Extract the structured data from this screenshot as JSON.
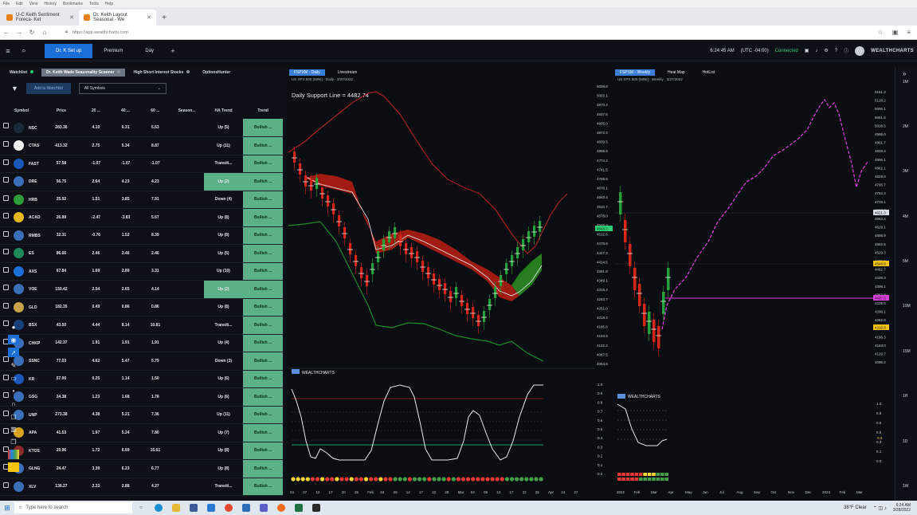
{
  "browser": {
    "menu": [
      "File",
      "Edit",
      "View",
      "History",
      "Bookmarks",
      "Tools",
      "Help"
    ],
    "tabs": [
      {
        "title": "U-C Keith Sentiment Foreca- Ket"
      },
      {
        "title": "Dr. Keith Layout Seasonal - We"
      }
    ],
    "url": "https://app.wealthcharts.com"
  },
  "app": {
    "tabs": [
      "Dr. K Set up",
      "Premium",
      "Day"
    ],
    "clock": "6:24:45 AM",
    "tz": "(UTC -04:00)",
    "status": "Connected",
    "logo": "WEALTHCHARTS"
  },
  "scanner": {
    "tabs": [
      "Watchlist",
      "Dr. Keith Wade Seasonality Scanner",
      "High Short Interest Stocks",
      "OptionsHunter"
    ],
    "add_watchlist": "Add to Watchlist",
    "filter": "All Symbols",
    "columns": [
      "Symbol",
      "Price",
      "20 ...",
      "40 ...",
      "60 ...",
      "Season...",
      "HA Trend",
      "Trend"
    ],
    "rows": [
      {
        "sym": "NSC",
        "price": "283.36",
        "c20": "4.10",
        "c40": "6.31",
        "c60": "5.63",
        "season": "",
        "ha": "Up (5)",
        "trend": "Bullish ...",
        "logo": "#1b2a3a",
        "ha_hi": false
      },
      {
        "sym": "CTAS",
        "price": "413.32",
        "c20": "2.75",
        "c40": "5.34",
        "c60": "8.87",
        "season": "",
        "ha": "Up (11)",
        "trend": "Bullish ...",
        "logo": "#f2f2f2",
        "ha_hi": false
      },
      {
        "sym": "FAST",
        "price": "57.58",
        "c20": "-1.07",
        "c40": "-1.07",
        "c60": "-1.07",
        "season": "",
        "ha": "Transiti...",
        "trend": "Bullish ...",
        "logo": "#1957b8",
        "ha_hi": false
      },
      {
        "sym": "DRE",
        "price": "56.75",
        "c20": "2.64",
        "c40": "4.23",
        "c60": "4.23",
        "season": "",
        "ha": "Up (2)",
        "trend": "Bullish ...",
        "logo": "#3a6fb8",
        "ha_hi": true
      },
      {
        "sym": "HRB",
        "price": "25.92",
        "c20": "1.51",
        "c40": "3.85",
        "c60": "7.91",
        "season": "",
        "ha": "Down (4)",
        "trend": "Bullish ...",
        "logo": "#2f9a3b",
        "ha_hi": false
      },
      {
        "sym": "ACAD",
        "price": "26.89",
        "c20": "-2.47",
        "c40": "-3.83",
        "c60": "5.67",
        "season": "",
        "ha": "Up (8)",
        "trend": "Bullish ...",
        "logo": "#e6b81c",
        "ha_hi": false
      },
      {
        "sym": "RMBS",
        "price": "32.31",
        "c20": "-0.76",
        "c40": "1.52",
        "c60": "8.39",
        "season": "",
        "ha": "Up (8)",
        "trend": "Bullish ...",
        "logo": "#3a6fb8",
        "ha_hi": false
      },
      {
        "sym": "ES",
        "price": "86.66",
        "c20": "2.46",
        "c40": "2.46",
        "c60": "2.46",
        "season": "",
        "ha": "Up (5)",
        "trend": "Bullish ...",
        "logo": "#1e8a5a",
        "ha_hi": false
      },
      {
        "sym": "AXS",
        "price": "67.84",
        "c20": "1.69",
        "c40": "2.89",
        "c60": "3.31",
        "season": "",
        "ha": "Up (10)",
        "trend": "Bullish ...",
        "logo": "#1b6fd6",
        "ha_hi": false
      },
      {
        "sym": "VOE",
        "price": "150.42",
        "c20": "2.54",
        "c40": "2.65",
        "c60": "4.14",
        "season": "",
        "ha": "Up (2)",
        "trend": "Bullish ...",
        "logo": "#3a6fb8",
        "ha_hi": true
      },
      {
        "sym": "GLD",
        "price": "182.35",
        "c20": "0.49",
        "c40": "0.86",
        "c60": "0.86",
        "season": "",
        "ha": "Up (8)",
        "trend": "Bullish ...",
        "logo": "#c9a24a",
        "ha_hi": false
      },
      {
        "sym": "BSX",
        "price": "43.50",
        "c20": "4.44",
        "c40": "8.14",
        "c60": "10.81",
        "season": "",
        "ha": "Transiti...",
        "trend": "Bullish ...",
        "logo": "#1b3f7a",
        "ha_hi": false
      },
      {
        "sym": "CHKP",
        "price": "142.37",
        "c20": "1.91",
        "c40": "1.91",
        "c60": "1.91",
        "season": "",
        "ha": "Up (4)",
        "trend": "Bullish ...",
        "logo": "#3a6fb8",
        "ha_hi": false
      },
      {
        "sym": "SSNC",
        "price": "77.03",
        "c20": "4.62",
        "c40": "5.47",
        "c60": "5.79",
        "season": "",
        "ha": "Down (3)",
        "trend": "Bullish ...",
        "logo": "#3a6fb8",
        "ha_hi": false
      },
      {
        "sym": "KR",
        "price": "57.00",
        "c20": "0.25",
        "c40": "1.14",
        "c60": "1.50",
        "season": "",
        "ha": "Up (6)",
        "trend": "Bullish ...",
        "logo": "#1957b8",
        "ha_hi": false
      },
      {
        "sym": "GSG",
        "price": "24.38",
        "c20": "1.23",
        "c40": "1.68",
        "c60": "1.78",
        "season": "",
        "ha": "Up (6)",
        "trend": "Bullish ...",
        "logo": "#3a6fb8",
        "ha_hi": false
      },
      {
        "sym": "UNP",
        "price": "273.38",
        "c20": "4.38",
        "c40": "5.21",
        "c60": "7.36",
        "season": "",
        "ha": "Up (11)",
        "trend": "Bullish ...",
        "logo": "#3a6fb8",
        "ha_hi": false
      },
      {
        "sym": "APA",
        "price": "41.53",
        "c20": "1.97",
        "c40": "5.24",
        "c60": "7.80",
        "season": "",
        "ha": "Up (7)",
        "trend": "Bullish ...",
        "logo": "#d9a21b",
        "ha_hi": false
      },
      {
        "sym": "KTOS",
        "price": "20.96",
        "c20": "1.72",
        "c40": "6.99",
        "c60": "15.61",
        "season": "",
        "ha": "Up (8)",
        "trend": "Bullish ...",
        "logo": "#8a2a2a",
        "ha_hi": false
      },
      {
        "sym": "GLNG",
        "price": "24.47",
        "c20": "3.39",
        "c40": "6.23",
        "c60": "6.77",
        "season": "",
        "ha": "Up (8)",
        "trend": "Bullish ...",
        "logo": "#3a6fb8",
        "ha_hi": false
      },
      {
        "sym": "XLV",
        "price": "136.27",
        "c20": "2.33",
        "c40": "2.88",
        "c60": "4.27",
        "season": "",
        "ha": "Transiti...",
        "trend": "Bullish ...",
        "logo": "#3a6fb8",
        "ha_hi": false
      }
    ]
  },
  "chart_daily": {
    "tabs": [
      "FSPXM - Daily",
      "Livestream"
    ],
    "subtitle": "US SPX 500 (MINI) · Daily · 3/27/2022",
    "annotation": "Daily Support Line = 4482.74",
    "price_ticks": [
      "5035.8",
      "5003.1",
      "4970.4",
      "4937.6",
      "4905.0",
      "4872.3",
      "4839.5",
      "4806.9",
      "4774.2",
      "4741.5",
      "4708.8",
      "4676.1",
      "4643.4",
      "4610.7",
      "4578.0",
      "4546.3",
      "4512.6",
      "4479.9",
      "4447.2",
      "4414.5",
      "4381.8",
      "4349.1",
      "4316.4",
      "4283.7",
      "4251.0",
      "4218.3",
      "4185.6",
      "4153.9",
      "4122.2",
      "4087.5",
      "4054.8"
    ],
    "current_price": "4546.3",
    "osc_ticks": [
      "1.0",
      "0.9",
      "0.8",
      "0.7",
      "0.6",
      "0.5",
      "0.4",
      "0.3",
      "0.2",
      "0.1",
      "0.0"
    ],
    "x_ticks": [
      "04",
      "07",
      "12",
      "17",
      "20",
      "25",
      "Feb",
      "04",
      "09",
      "14",
      "17",
      "22",
      "28",
      "Mar",
      "04",
      "09",
      "14",
      "17",
      "22",
      "25",
      "Apr",
      "24",
      "27"
    ],
    "osc_logo": "WEALTHCHARTS"
  },
  "chart_weekly": {
    "tabs": [
      "FSPXM - Weekly",
      "Heat Map",
      "HotList"
    ],
    "subtitle": "US SPX 500 (MINI) · Weekly · 3/27/2022",
    "price_ticks": [
      "5161.3",
      "5128.2",
      "5095.1",
      "5061.6",
      "5028.5",
      "4995.0",
      "4961.7",
      "4928.4",
      "4895.1",
      "4862.1",
      "4829.0",
      "4795.7",
      "4762.3",
      "4729.1",
      "4695.7",
      "4662.4",
      "4629.1",
      "4595.9",
      "4562.6",
      "4529.3",
      "4495.9",
      "4462.7",
      "4429.3",
      "4396.1",
      "4362.8",
      "4329.5",
      "4296.1",
      "4262.8",
      "4229.6",
      "4196.3",
      "4163.0",
      "4129.7",
      "4096.4"
    ],
    "labels": [
      "4621.3",
      "4548.8",
      "4437.5",
      "4216.8"
    ],
    "osc_ticks": [
      "1.0",
      "0.8",
      "0.6",
      "0.5",
      "0.3",
      "0.1",
      "0.0"
    ],
    "osc_marker": "0.3",
    "x_ticks": [
      "2022",
      "Feb",
      "Mar",
      "Apr",
      "May",
      "Jun",
      "Jul",
      "Aug",
      "Sep",
      "Oct",
      "Nov",
      "Dec",
      "2023",
      "Feb",
      "Mar"
    ],
    "osc_logo": "WEALTHCHARTS"
  },
  "right_rail": [
    "1M",
    "2M",
    "3M",
    "4M",
    "5M",
    "10M",
    "15M",
    "1H",
    "1D",
    "1W"
  ],
  "taskbar": {
    "search": "Type here to search",
    "weather": "38°F Clear",
    "time": "6:24 AM",
    "date": "3/28/2022"
  }
}
